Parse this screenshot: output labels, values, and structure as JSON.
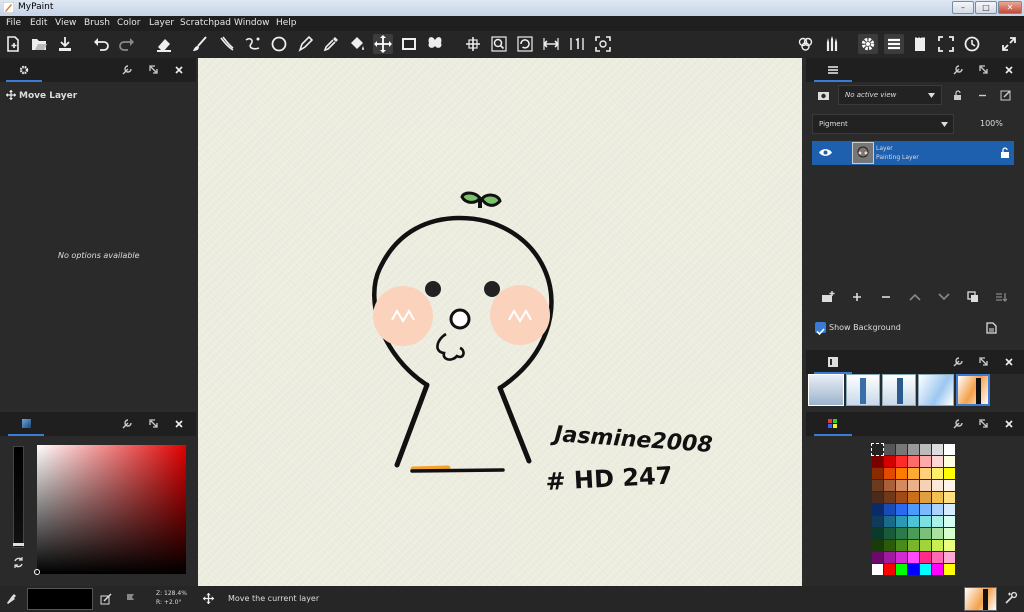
{
  "window": {
    "title": "MyPaint",
    "minimize": "–",
    "restore": "□",
    "close": "✕"
  },
  "menu": [
    "File",
    "Edit",
    "View",
    "Brush",
    "Color",
    "Layer",
    "Scratchpad",
    "Window",
    "Help"
  ],
  "tool_options": {
    "title": "Move Layer",
    "empty_message": "No options available"
  },
  "layers": {
    "view_select": "No active view",
    "mode_select": "Pigment",
    "opacity": "100%",
    "items": [
      {
        "name": "Layer",
        "type": "Painting Layer",
        "visible": true
      }
    ],
    "show_background_label": "Show Background",
    "show_background_checked": true
  },
  "canvas": {
    "signature_line1": "Jasmine2008",
    "signature_line2": "# HD 247"
  },
  "statusbar": {
    "zoom": "Z: 128.4%",
    "rotation": "R: +2.0°",
    "message": "Move the current layer"
  },
  "colors": {
    "accent": "#3a7bd5",
    "current_color": "#000000",
    "canvas_paper": "#efefe2",
    "cheek": "#fbd3bd",
    "sprout": "#7ac36a",
    "palette": [
      [
        "#222222",
        "#555555",
        "#777777",
        "#999999",
        "#bbbbbb",
        "#dddddd",
        "#ffffff"
      ],
      [
        "#7a0000",
        "#d40000",
        "#ff2a2a",
        "#ff6a6a",
        "#ffaaaa",
        "#ffd6d6",
        "#ffffe0"
      ],
      [
        "#8a2a00",
        "#e24a00",
        "#ff7a00",
        "#ffaa33",
        "#ffd27a",
        "#fff06a",
        "#ffff00"
      ],
      [
        "#6a3b1e",
        "#a9603a",
        "#d28a5e",
        "#e9b089",
        "#f5d2b3",
        "#fbe8d6",
        "#fff4e6"
      ],
      [
        "#4a2a1a",
        "#703a1a",
        "#a04a1a",
        "#c9701a",
        "#e0a040",
        "#f0c050",
        "#ffe080"
      ],
      [
        "#0a2a6a",
        "#1a4ab4",
        "#2a6af0",
        "#4a9aff",
        "#7ab8ff",
        "#aad4ff",
        "#d6ecff"
      ],
      [
        "#103a5a",
        "#1a6a8a",
        "#2a9ab4",
        "#4ac4d4",
        "#7ae0e0",
        "#aaf0e8",
        "#d6fff4"
      ],
      [
        "#0a3a2a",
        "#1a5a3a",
        "#2a7a4a",
        "#4a9a5a",
        "#7ac07a",
        "#aae0a0",
        "#d6ffd0"
      ],
      [
        "#1a3a0a",
        "#2a5a0a",
        "#4a8a1a",
        "#7ab42a",
        "#a0d43a",
        "#c8f050",
        "#eaff80"
      ],
      [
        "#6a0a6a",
        "#a01aa0",
        "#d42ad4",
        "#ff4aff",
        "#ff2a8a",
        "#ff6ab4",
        "#ffaad4"
      ],
      [
        "#ffffff",
        "#ff0000",
        "#00ff00",
        "#0000ff",
        "#00ffff",
        "#ff00ff",
        "#ffff00"
      ]
    ]
  }
}
